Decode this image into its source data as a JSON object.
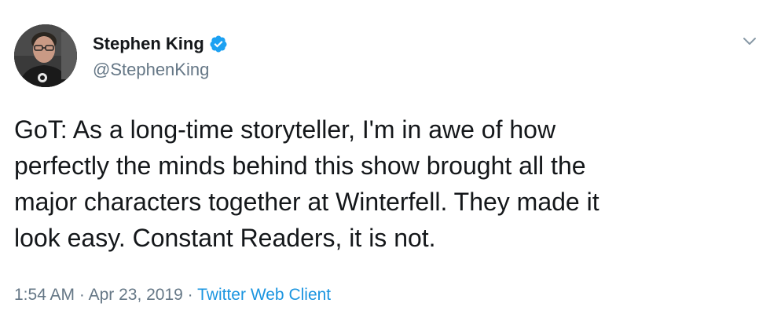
{
  "author": {
    "display_name": "Stephen King",
    "handle": "@StephenKing",
    "verified": true,
    "avatar_icon": "profile-photo"
  },
  "tweet": {
    "lines": [
      "GoT: As a long-time storyteller, I'm in awe of how",
      "perfectly the minds behind this show brought all the",
      "major characters together at Winterfell. They made it",
      "look easy. Constant Readers, it is not."
    ]
  },
  "meta": {
    "time": "1:54 AM",
    "sep1": " · ",
    "date": "Apr 23, 2019",
    "sep2": " · ",
    "source": "Twitter Web Client"
  },
  "menu": {
    "icon": "chevron-down-icon"
  },
  "colors": {
    "text": "#14171a",
    "secondary": "#657786",
    "accent": "#1b95e0",
    "verified": "#1da1f2"
  }
}
